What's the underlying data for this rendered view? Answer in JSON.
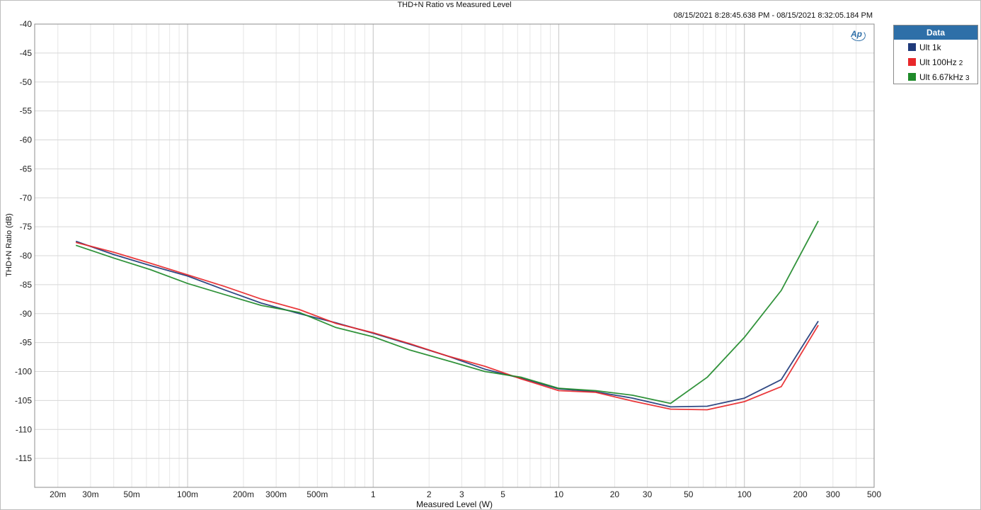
{
  "header": {
    "title": "THD+N Ratio vs Measured Level",
    "timestamp": "08/15/2021 8:28:45.638 PM - 08/15/2021 8:32:05.184 PM"
  },
  "logo": {
    "text": "Ap"
  },
  "legend": {
    "title": "Data",
    "items": [
      {
        "label": "Ult 1k",
        "suffix": "",
        "color": "#1f3a7a"
      },
      {
        "label": "Ult 100Hz",
        "suffix": "2",
        "color": "#e8282b"
      },
      {
        "label": "Ult 6.67kHz",
        "suffix": "3",
        "color": "#1f8a2a"
      }
    ]
  },
  "chart_data": {
    "type": "line",
    "title": "THD+N Ratio vs Measured Level",
    "xlabel": "Measured Level (W)",
    "ylabel": "THD+N Ratio (dB)",
    "x_scale": "log",
    "xlim": [
      0.015,
      500
    ],
    "ylim": [
      -120,
      -40
    ],
    "grid": true,
    "legend_position": "right",
    "x_ticks": [
      {
        "value": 0.02,
        "label": "20m"
      },
      {
        "value": 0.03,
        "label": "30m"
      },
      {
        "value": 0.05,
        "label": "50m"
      },
      {
        "value": 0.1,
        "label": "100m"
      },
      {
        "value": 0.2,
        "label": "200m"
      },
      {
        "value": 0.3,
        "label": "300m"
      },
      {
        "value": 0.5,
        "label": "500m"
      },
      {
        "value": 1,
        "label": "1"
      },
      {
        "value": 2,
        "label": "2"
      },
      {
        "value": 3,
        "label": "3"
      },
      {
        "value": 5,
        "label": "5"
      },
      {
        "value": 10,
        "label": "10"
      },
      {
        "value": 20,
        "label": "20"
      },
      {
        "value": 30,
        "label": "30"
      },
      {
        "value": 50,
        "label": "50"
      },
      {
        "value": 100,
        "label": "100"
      },
      {
        "value": 200,
        "label": "200"
      },
      {
        "value": 300,
        "label": "300"
      },
      {
        "value": 500,
        "label": "500"
      }
    ],
    "y_ticks": [
      -40,
      -45,
      -50,
      -55,
      -60,
      -65,
      -70,
      -75,
      -80,
      -85,
      -90,
      -95,
      -100,
      -105,
      -110,
      -115
    ],
    "series": [
      {
        "name": "Ult 1k",
        "color": "#1f3a7a",
        "x": [
          0.025,
          0.04,
          0.063,
          0.1,
          0.158,
          0.25,
          0.4,
          0.63,
          1,
          1.58,
          2.5,
          4,
          6.3,
          10,
          15.8,
          25,
          40,
          63,
          100,
          158,
          250
        ],
        "y": [
          -77.5,
          -79.8,
          -81.7,
          -83.5,
          -85.9,
          -88.2,
          -90.0,
          -91.6,
          -93.4,
          -95.3,
          -97.3,
          -99.6,
          -101.2,
          -103.0,
          -103.5,
          -104.6,
          -106.1,
          -106.0,
          -104.6,
          -101.4,
          -91.3
        ]
      },
      {
        "name": "Ult 100Hz",
        "color": "#e8282b",
        "x": [
          0.025,
          0.04,
          0.063,
          0.1,
          0.158,
          0.25,
          0.4,
          0.63,
          1,
          1.58,
          2.5,
          4,
          6.3,
          10,
          15.8,
          25,
          40,
          63,
          100,
          158,
          250
        ],
        "y": [
          -77.7,
          -79.4,
          -81.3,
          -83.3,
          -85.3,
          -87.5,
          -89.3,
          -91.7,
          -93.3,
          -95.2,
          -97.3,
          -99.1,
          -101.3,
          -103.3,
          -103.6,
          -105.1,
          -106.5,
          -106.6,
          -105.2,
          -102.6,
          -92.0
        ]
      },
      {
        "name": "Ult 6.67kHz",
        "color": "#1f8a2a",
        "x": [
          0.025,
          0.04,
          0.063,
          0.1,
          0.158,
          0.25,
          0.4,
          0.63,
          1,
          1.58,
          2.5,
          4,
          6.3,
          10,
          15.8,
          25,
          40,
          63,
          100,
          158,
          250
        ],
        "y": [
          -78.2,
          -80.4,
          -82.4,
          -84.8,
          -86.7,
          -88.6,
          -89.8,
          -92.4,
          -94.0,
          -96.3,
          -98.1,
          -100.0,
          -101.0,
          -102.9,
          -103.3,
          -104.1,
          -105.5,
          -101.0,
          -94.1,
          -86.0,
          -74.0
        ]
      }
    ]
  }
}
